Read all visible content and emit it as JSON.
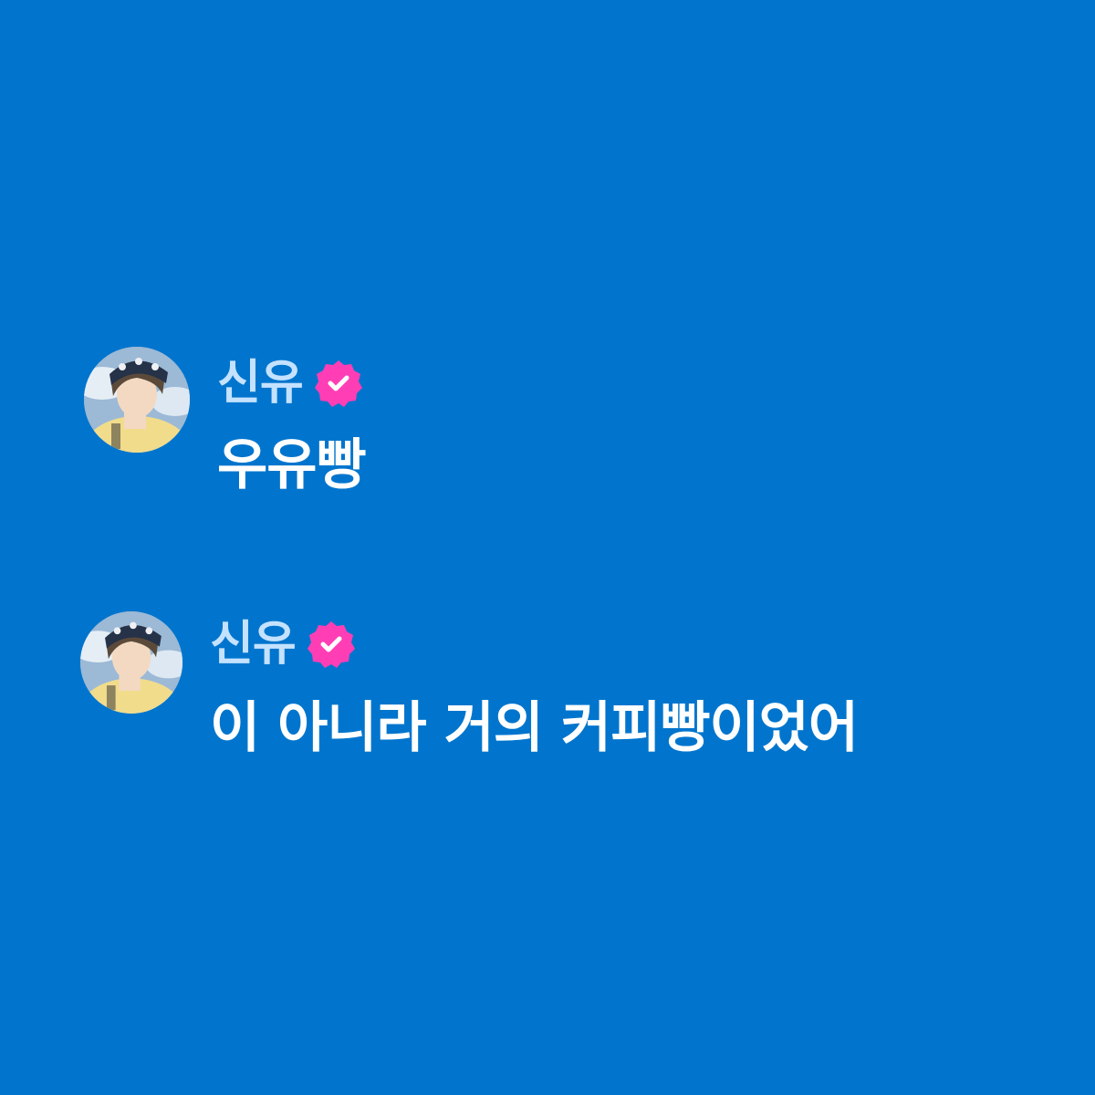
{
  "colors": {
    "background": "#0175CD",
    "username": "#C4E2FF",
    "message_text": "#FFFFFF",
    "verified_badge": "#FF3EB5"
  },
  "messages": [
    {
      "username": "신유",
      "verified": true,
      "badge_icon": "verified-badge-icon",
      "avatar": "avatar-photo",
      "text": "우유빵"
    },
    {
      "username": "신유",
      "verified": true,
      "badge_icon": "verified-badge-icon",
      "avatar": "avatar-photo",
      "text": "이 아니라 거의 커피빵이었어"
    }
  ]
}
